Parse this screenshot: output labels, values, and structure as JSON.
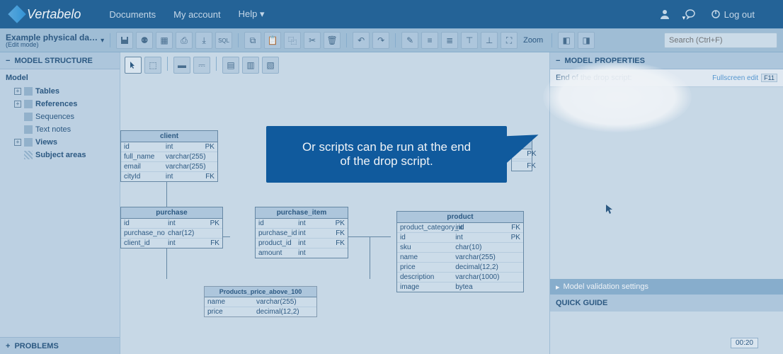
{
  "topnav": {
    "brand": "Vertabelo",
    "links": {
      "documents": "Documents",
      "account": "My account",
      "help": "Help"
    },
    "logout": "Log out"
  },
  "toolbar": {
    "docname": "Example physical da…",
    "mode": "(Edit mode)",
    "zoom_label": "Zoom",
    "search_placeholder": "Search (Ctrl+F)"
  },
  "left": {
    "header": "MODEL STRUCTURE",
    "root": "Model",
    "items": [
      "Tables",
      "References",
      "Sequences",
      "Text notes",
      "Views",
      "Subject areas"
    ],
    "problems": "PROBLEMS"
  },
  "right": {
    "header": "MODEL PROPERTIES",
    "drop_label": "End of the drop script:",
    "fullscreen": "Fullscreen edit",
    "fullscreen_key": "F11",
    "validation": "Model validation settings",
    "quickguide": "QUICK GUIDE",
    "timestamp": "00:20"
  },
  "callout": {
    "line1": "Or scripts can be run at the end",
    "line2": "of the drop script."
  },
  "entities": {
    "client": {
      "title": "client",
      "cols": [
        {
          "n": "id",
          "t": "int",
          "k": "PK"
        },
        {
          "n": "full_name",
          "t": "varchar(255)",
          "k": ""
        },
        {
          "n": "email",
          "t": "varchar(255)",
          "k": ""
        },
        {
          "n": "cityId",
          "t": "int",
          "k": "FK"
        }
      ]
    },
    "purchase": {
      "title": "purchase",
      "cols": [
        {
          "n": "id",
          "t": "int",
          "k": "PK"
        },
        {
          "n": "purchase_no",
          "t": "char(12)",
          "k": ""
        },
        {
          "n": "client_id",
          "t": "int",
          "k": "FK"
        }
      ]
    },
    "purchase_item": {
      "title": "purchase_item",
      "cols": [
        {
          "n": "id",
          "t": "int",
          "k": "PK"
        },
        {
          "n": "purchase_id",
          "t": "int",
          "k": "FK"
        },
        {
          "n": "product_id",
          "t": "int",
          "k": "FK"
        },
        {
          "n": "amount",
          "t": "int",
          "k": ""
        }
      ]
    },
    "product": {
      "title": "product",
      "cols": [
        {
          "n": "product_category_id",
          "t": "int",
          "k": "FK"
        },
        {
          "n": "id",
          "t": "int",
          "k": "PK"
        },
        {
          "n": "sku",
          "t": "char(10)",
          "k": ""
        },
        {
          "n": "name",
          "t": "varchar(255)",
          "k": ""
        },
        {
          "n": "price",
          "t": "decimal(12,2)",
          "k": ""
        },
        {
          "n": "description",
          "t": "varchar(1000)",
          "k": ""
        },
        {
          "n": "image",
          "t": "bytea",
          "k": ""
        }
      ]
    },
    "partial": {
      "cols": [
        {
          "n": "",
          "t": "",
          "k": "PK"
        },
        {
          "n": "",
          "t": "",
          "k": ""
        },
        {
          "n": "",
          "t": "",
          "k": "FK"
        }
      ]
    },
    "view1": {
      "title": "Products_price_above_100",
      "cols": [
        {
          "n": "name",
          "t": "varchar(255)",
          "k": ""
        },
        {
          "n": "price",
          "t": "decimal(12,2)",
          "k": ""
        }
      ]
    }
  }
}
